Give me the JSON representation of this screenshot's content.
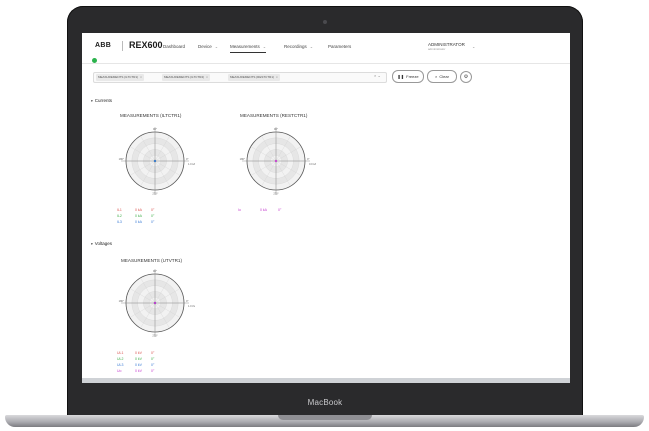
{
  "device": {
    "brand": "MacBook"
  },
  "app": {
    "logo": "ABB",
    "product": "REX600",
    "status_color": "#2bb24c",
    "nav": [
      {
        "label": "Dashboard",
        "has_menu": false,
        "active": false
      },
      {
        "label": "Device",
        "has_menu": true,
        "active": false
      },
      {
        "label": "Measurements",
        "has_menu": true,
        "active": true
      },
      {
        "label": "Recordings",
        "has_menu": true,
        "active": false
      },
      {
        "label": "Parameters",
        "has_menu": false,
        "active": false
      }
    ],
    "user": {
      "name": "ADMINISTRATOR",
      "role": "administrator"
    }
  },
  "toolbar": {
    "chips": [
      "MEASUREMENTS (ILTCTR1)",
      "MEASUREMENTS (ILTCTR2)",
      "MEASUREMENTS (RESTCTR1)"
    ],
    "clear_icon": "close-icon",
    "expand_icon": "chevron-down-icon",
    "freeze_label": "Freeze",
    "clear_label": "Clear",
    "settings_icon": "gear-icon"
  },
  "sections": [
    {
      "title": "Currents",
      "charts": [
        {
          "title": "MEASUREMENTS (ILTCTR1)",
          "axis": {
            "top": "90°",
            "left": "180°",
            "right": "0°",
            "bottom": "270°"
          },
          "scale_label": "1.0 kA",
          "rows": [
            {
              "name": "IL1",
              "value": "0 kA",
              "angle": "0°",
              "color": "#d9534f"
            },
            {
              "name": "IL2",
              "value": "0 kA",
              "angle": "0°",
              "color": "#3fae49"
            },
            {
              "name": "IL3",
              "value": "0 kA",
              "angle": "0°",
              "color": "#3a7bd5"
            }
          ]
        },
        {
          "title": "MEASUREMENTS (RESTCTR1)",
          "axis": {
            "top": "90°",
            "left": "180°",
            "right": "0°",
            "bottom": "270°"
          },
          "scale_label": "0.0 kA",
          "rows": [
            {
              "name": "Io",
              "value": "0 kA",
              "angle": "0°",
              "color": "#c43ccf"
            }
          ]
        }
      ]
    },
    {
      "title": "Voltages",
      "charts": [
        {
          "title": "MEASUREMENTS (UTVTR1)",
          "axis": {
            "top": "90°",
            "left": "180°",
            "right": "0°",
            "bottom": "270°"
          },
          "scale_label": "1.0 kV",
          "rows": [
            {
              "name": "UL1",
              "value": "0 kV",
              "angle": "0°",
              "color": "#d9534f"
            },
            {
              "name": "UL2",
              "value": "0 kV",
              "angle": "0°",
              "color": "#3fae49"
            },
            {
              "name": "UL3",
              "value": "0 kV",
              "angle": "0°",
              "color": "#3a7bd5"
            },
            {
              "name": "Uo",
              "value": "0 kV",
              "angle": "0°",
              "color": "#c43ccf"
            }
          ]
        }
      ]
    }
  ]
}
